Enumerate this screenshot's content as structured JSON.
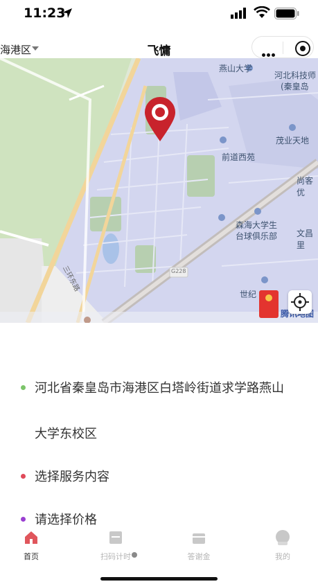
{
  "status_bar": {
    "time": "11:23"
  },
  "header": {
    "district": "海港区",
    "title": "飞慵"
  },
  "map": {
    "labels": [
      "燕山大学",
      "河北科技师",
      "(秦皇岛",
      "茂业天地",
      "前道西苑",
      "尚客优",
      "森海大学生",
      "台球俱乐部",
      "文昌里",
      "世纪",
      "G228",
      "三环东路",
      "腾讯地图"
    ],
    "attribution": "腾讯地图",
    "road_badge": "G228"
  },
  "address": {
    "line1": "河北省秦皇岛市海港区白塔岭街道求学路燕山",
    "line2": "大学东校区",
    "color": "#7cc46a"
  },
  "service": {
    "label": "选择服务内容",
    "color": "#e04a5a"
  },
  "price": {
    "label": "请选择价格",
    "color": "#9a3fd1"
  },
  "tabs": [
    {
      "label": "首页",
      "icon": "home-icon",
      "active": true
    },
    {
      "label": "扫码计时",
      "icon": "scan-icon",
      "active": false
    },
    {
      "label": "答谢金",
      "icon": "gift-icon",
      "active": false
    },
    {
      "label": "我的",
      "icon": "profile-icon",
      "active": false
    }
  ]
}
